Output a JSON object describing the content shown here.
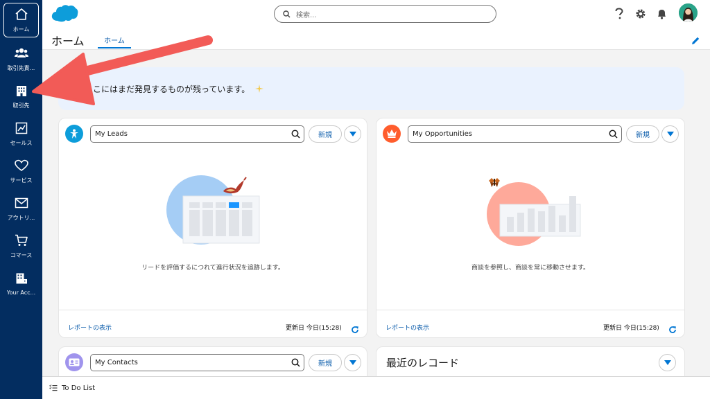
{
  "nav": {
    "items": [
      {
        "label": "ホーム",
        "icon": "home-icon"
      },
      {
        "label": "取引先責...",
        "icon": "contacts-icon"
      },
      {
        "label": "取引先",
        "icon": "building-icon"
      },
      {
        "label": "セールス",
        "icon": "chart-icon"
      },
      {
        "label": "サービス",
        "icon": "heart-icon"
      },
      {
        "label": "アウトリ...",
        "icon": "mail-icon"
      },
      {
        "label": "コマース",
        "icon": "cart-icon"
      },
      {
        "label": "Your Acc...",
        "icon": "account-icon"
      }
    ]
  },
  "header": {
    "search_placeholder": "検索...",
    "page_title": "ホーム",
    "tab_label": "ホーム"
  },
  "banner": {
    "text": "ここにはまだ発見するものが残っています。"
  },
  "cards": {
    "leads": {
      "list_name": "My Leads",
      "new_label": "新規",
      "empty_text": "リードを評価するにつれて進行状況を追跡します。",
      "report_link": "レポートの表示",
      "updated": "更新日 今日(15:28)"
    },
    "opportunities": {
      "list_name": "My Opportunities",
      "new_label": "新規",
      "empty_text": "商談を参照し、商談を常に移動させます。",
      "report_link": "レポートの表示",
      "updated": "更新日 今日(15:28)"
    },
    "contacts": {
      "list_name": "My Contacts",
      "new_label": "新規"
    },
    "recent": {
      "title": "最近のレコード"
    }
  },
  "bottombar": {
    "label": "To Do List"
  },
  "colors": {
    "nav_bg": "#032d60",
    "brand_blue": "#0176d3",
    "link_blue": "#0b5cab",
    "leads_icon": "#0d9dda",
    "opportunities_icon": "#ff5d2d",
    "contacts_icon": "#a094ed",
    "annotation_arrow": "#f25b57"
  }
}
